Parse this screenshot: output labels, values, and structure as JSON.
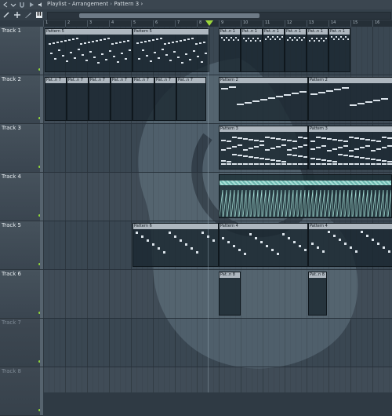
{
  "window": {
    "title": "Playlist - Arrangement",
    "separator": "›",
    "pattern": "Pattern 3",
    "title_suffix": "›"
  },
  "colors": {
    "accent": "#9cd63a",
    "clip_head": "#aeb7bf",
    "note": "#dbe3ea"
  },
  "ruler": {
    "bars": [
      "1",
      "2",
      "3",
      "4",
      "5",
      "6",
      "7",
      "8",
      "9",
      "10",
      "11",
      "12",
      "13",
      "14",
      "15",
      "16"
    ]
  },
  "tracks": [
    {
      "name": "Track 1"
    },
    {
      "name": "Track 2"
    },
    {
      "name": "Track 3"
    },
    {
      "name": "Track 4"
    },
    {
      "name": "Track 5"
    },
    {
      "name": "Track 6"
    },
    {
      "name": "Track 7"
    },
    {
      "name": "Track 8"
    }
  ],
  "clips": {
    "t1a": "Pattern 5",
    "t1b": "Pattern 5",
    "t1c": "Pat..n 1",
    "t1d": "Pat..n 1",
    "t1e": "Pat..n 1",
    "t1f": "Pat..n 1",
    "t1g": "Pat..n 1",
    "t1h": "Pat..n 1",
    "t2a": "Pat..n 7",
    "t2b": "Pat..n 7",
    "t2c": "Pat..n 7",
    "t2d": "Pat..n 7",
    "t2e": "Pat..n 7",
    "t2f": "Pat..n 7",
    "t2g": "Pat..n 7",
    "t2h": "Pattern 2",
    "t2i": "Pattern 2",
    "t3a": "Pattern 3",
    "t3b": "Pattern 3",
    "t5a": "Pattern 6",
    "t5b": "Pattern 4",
    "t5c": "Pattern 4",
    "t6a": "Pat..n 8",
    "t6b": "Pat..n 8"
  }
}
